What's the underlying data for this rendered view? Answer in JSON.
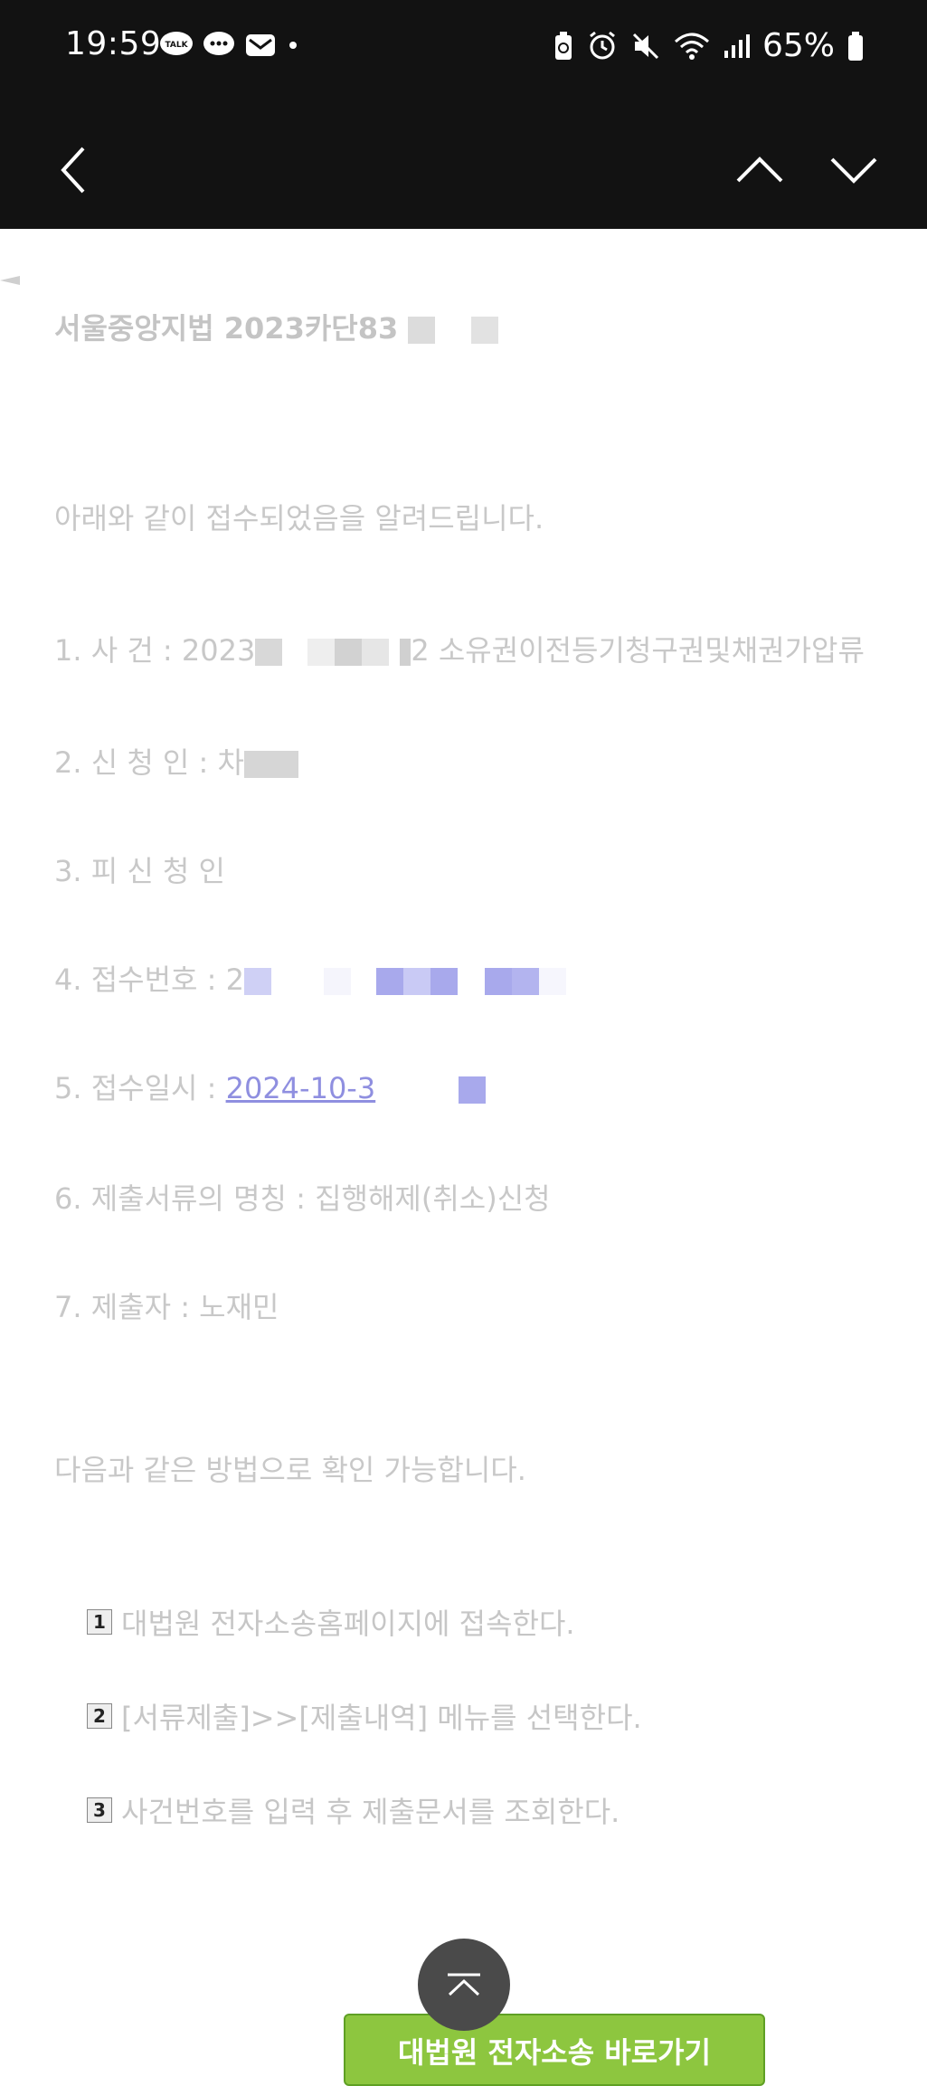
{
  "status": {
    "time": "19:59",
    "battery": "65%",
    "left_icons": [
      "kakaotalk-icon",
      "chat-bubble-icon",
      "mail-icon",
      "dot-icon"
    ],
    "right_icons": [
      "battery-saver-icon",
      "alarm-icon",
      "mute-icon",
      "wifi-icon",
      "signal-icon",
      "battery-icon"
    ]
  },
  "nav": {
    "back": "back",
    "prev": "previous",
    "next": "next"
  },
  "document": {
    "title": "서울중앙지법 2023카단83",
    "intro": "아래와 같이 접수되었음을 알려드립니다.",
    "item1_label": "1. 사   건 : 2023",
    "item1_suffix": "2 소유권이전등기청구권및채권가압류",
    "item2_label": "2. 신 청 인 : 차",
    "item3_label": "3. 피 신 청 인",
    "item4_label": "4. 접수번호 : 2",
    "item5_label": "5. 접수일시 : ",
    "item5_link": "2024-10-3",
    "item6_label": "6. 제출서류의 명칭 : 집행해제(취소)신청",
    "item7_label": "7. 제출자 : 노재민",
    "method_intro": "다음과 같은 방법으로 확인 가능합니다.",
    "steps": [
      {
        "num": "1",
        "text": "대법원 전자소송홈페이지에 접속한다."
      },
      {
        "num": "2",
        "text": "[서류제출]>>[제출내역] 메뉴를 선택한다."
      },
      {
        "num": "3",
        "text": "사건번호를 입력 후 제출문서를 조회한다."
      }
    ],
    "button_label": "대법원 전자소송 바로가기"
  },
  "colors": {
    "bar": "#121212",
    "text": "#c8c8c8",
    "link": "#8f8fe0",
    "green": "#8dc63f"
  }
}
